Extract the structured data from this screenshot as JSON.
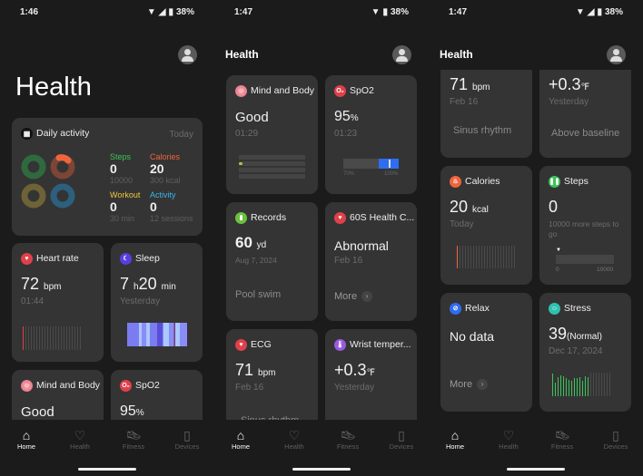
{
  "status": [
    {
      "time": "1:46",
      "battery": "38%"
    },
    {
      "time": "1:47",
      "battery": "38%"
    },
    {
      "time": "1:47",
      "battery": "38%"
    }
  ],
  "header": {
    "title": "Health"
  },
  "daily": {
    "title": "Daily activity",
    "period": "Today",
    "stats": [
      {
        "label": "Steps",
        "value": "0",
        "goal": "10000",
        "color": "#3cc35a"
      },
      {
        "label": "Calories",
        "value": "20",
        "goal": "300 kcal",
        "color": "#f0643c"
      },
      {
        "label": "Workout",
        "value": "0",
        "goal": "30 min",
        "color": "#f0c83c"
      },
      {
        "label": "Activity",
        "value": "0",
        "goal": "12 sessions",
        "color": "#3cb4f0"
      }
    ]
  },
  "cards": {
    "heart": {
      "title": "Heart rate",
      "value": "72",
      "unit": "bpm",
      "sub": "01:44"
    },
    "sleep": {
      "title": "Sleep",
      "h": "7",
      "hu": "h",
      "m": "20",
      "mu": "min",
      "sub": "Yesterday"
    },
    "mind": {
      "title": "Mind and Body",
      "value": "Good",
      "sub": "01:29"
    },
    "spo2": {
      "title": "SpO2",
      "value": "95",
      "unit": "%",
      "sub": "01:23",
      "min": "70%",
      "max": "100%",
      "level": 0.95
    },
    "records": {
      "title": "Records",
      "value": "60",
      "unit": "yd",
      "sub": "Aug 7, 2024",
      "note": "Pool swim"
    },
    "health60": {
      "title": "60S Health C...",
      "value": "Abnormal",
      "sub": "Feb 16",
      "more": "More"
    },
    "ecg": {
      "title": "ECG",
      "value": "71",
      "unit": "bpm",
      "sub": "Feb 16",
      "note": "Sinus rhythm"
    },
    "wrist": {
      "title": "Wrist temper...",
      "value": "+0.3",
      "unit": "℉",
      "sub": "Yesterday",
      "note": "Above baseline"
    },
    "calories": {
      "title": "Calories",
      "value": "20",
      "unit": "kcal",
      "sub": "Today"
    },
    "steps": {
      "title": "Steps",
      "value": "0",
      "sub": "10000 more steps to go",
      "min": "0",
      "max": "10000",
      "progress": 0
    },
    "relax": {
      "title": "Relax",
      "value": "No data",
      "more": "More"
    },
    "stress": {
      "title": "Stress",
      "value": "39",
      "unit": "(Normal)",
      "sub": "Dec 17, 2024"
    }
  },
  "mini_charts": {
    "stress": [
      36,
      22,
      30,
      33,
      31,
      28,
      26,
      25,
      29,
      28,
      30,
      24,
      32,
      30,
      0,
      0,
      0,
      0,
      0,
      0,
      0,
      0
    ],
    "heart": [
      1
    ]
  },
  "nav": [
    "Home",
    "Health",
    "Fitness",
    "Devices"
  ],
  "colors": {
    "bg": "#1b1b1b",
    "card": "#343434",
    "stress": "#3cc35a",
    "calories": "#f0643c",
    "heart": "#e0404a",
    "spo2": "#2f6df0"
  }
}
